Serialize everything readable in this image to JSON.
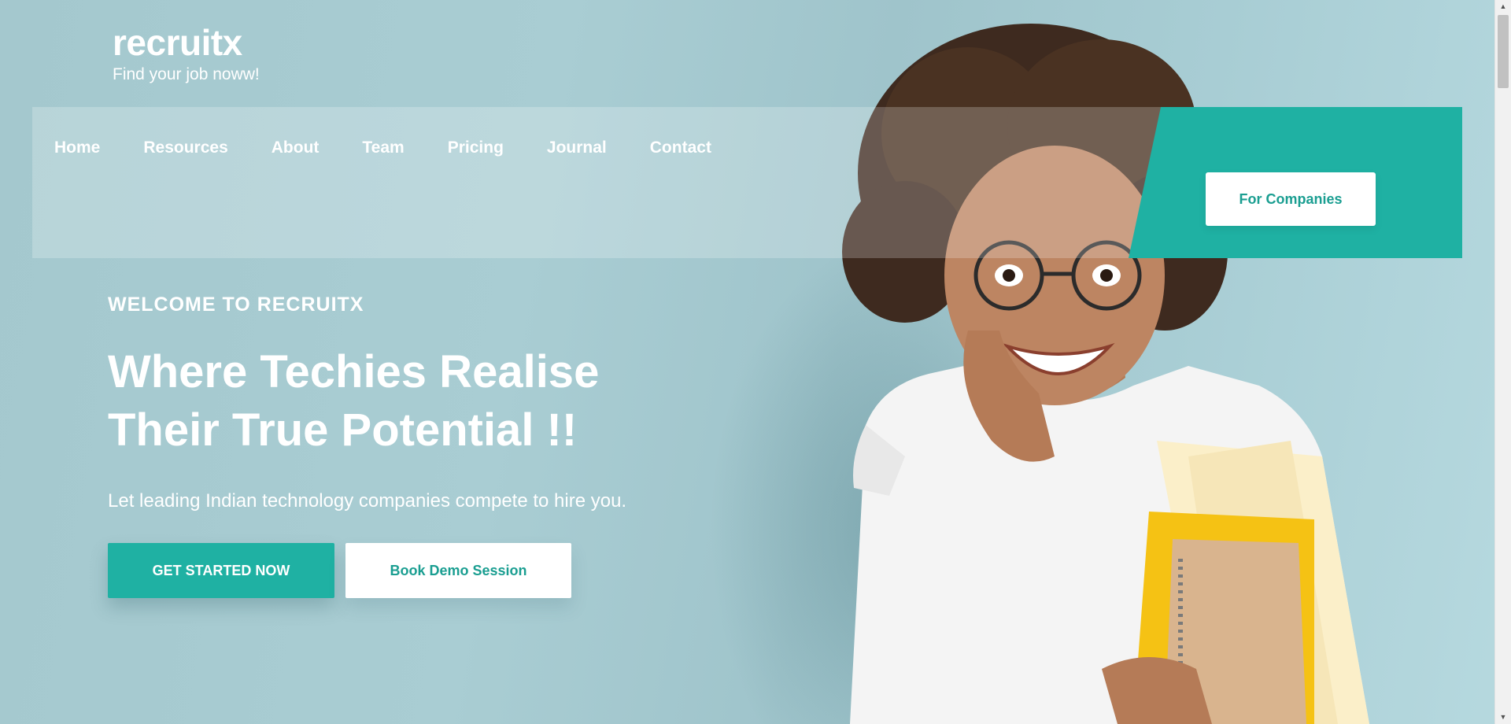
{
  "brand": {
    "name": "recruitx",
    "tagline": "Find your job noww!"
  },
  "nav": {
    "items": [
      {
        "label": "Home"
      },
      {
        "label": "Resources"
      },
      {
        "label": "About"
      },
      {
        "label": "Team"
      },
      {
        "label": "Pricing"
      },
      {
        "label": "Journal"
      },
      {
        "label": "Contact"
      }
    ],
    "companies_button": "For Companies"
  },
  "hero": {
    "eyebrow": "WELCOME TO RECRUITX",
    "headline": "Where Techies Realise Their True Potential !!",
    "subheadline": "Let leading Indian technology companies compete to hire you.",
    "primary_cta": "GET STARTED NOW",
    "secondary_cta": "Book Demo Session"
  },
  "colors": {
    "accent": "#1fb1a3",
    "background": "#a6cbd1",
    "text": "#ffffff"
  },
  "icons": {
    "scroll_up": "triangle-up",
    "scroll_down": "triangle-down"
  }
}
